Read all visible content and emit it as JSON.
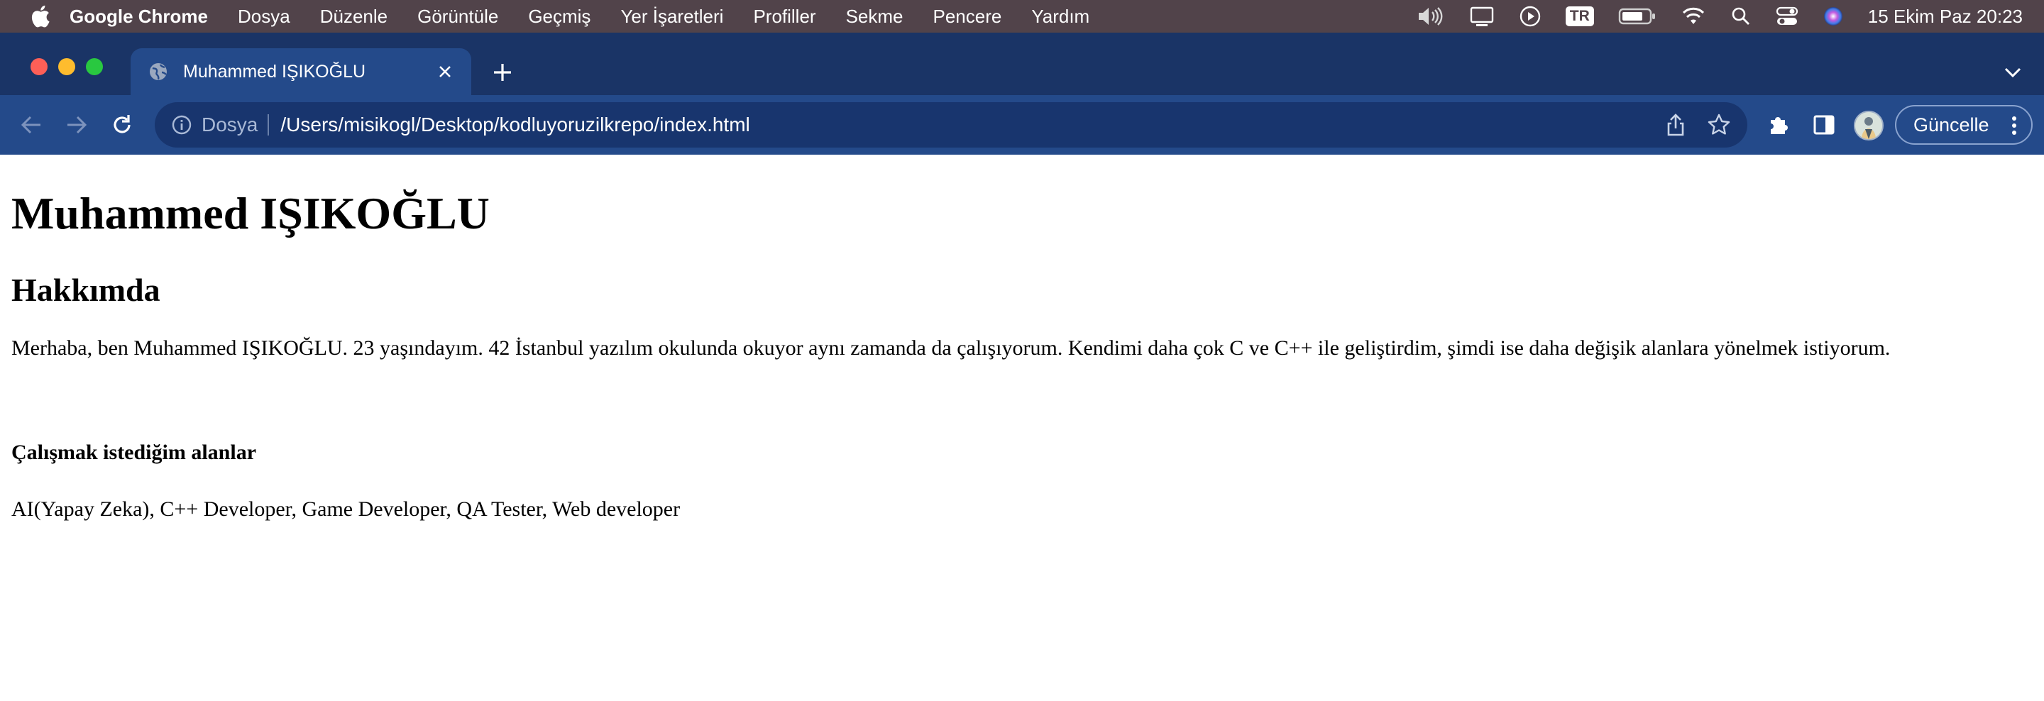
{
  "menubar": {
    "app_name": "Google Chrome",
    "items": [
      "Dosya",
      "Düzenle",
      "Görüntüle",
      "Geçmiş",
      "Yer İşaretleri",
      "Profiller",
      "Sekme",
      "Pencere",
      "Yardım"
    ],
    "input_source": "TR",
    "clock": "15 Ekim Paz  20:23",
    "tray_icons": [
      "volume-icon",
      "screen-mirroring-icon",
      "play-icon",
      "input-source-badge",
      "battery-icon",
      "wifi-icon",
      "spotlight-search-icon",
      "control-center-icon",
      "siri-icon"
    ]
  },
  "browser": {
    "tab": {
      "title": "Muhammed IŞIKOĞLU",
      "icon": "globe-icon"
    },
    "address_bar": {
      "scheme_label": "Dosya",
      "url": "/Users/misikogl/Desktop/kodluyoruzilkrepo/index.html"
    },
    "update_button": "Güncelle",
    "colors": {
      "tabstrip": "#1a3466",
      "toolbar": "#244a8a",
      "omnibox": "#18356e"
    }
  },
  "page": {
    "title": "Muhammed IŞIKOĞLU",
    "about_heading": "Hakkımda",
    "about_text": "Merhaba, ben Muhammed IŞIKOĞLU. 23 yaşındayım. 42 İstanbul yazılım okulunda okuyor aynı zamanda da çalışıyorum. Kendimi daha çok C ve C++ ile geliştirdim, şimdi ise daha değişik alanlara yönelmek istiyorum.",
    "fields_heading": "Çalışmak istediğim alanlar",
    "fields_text": "AI(Yapay Zeka), C++ Developer, Game Developer, QA Tester, Web developer"
  }
}
